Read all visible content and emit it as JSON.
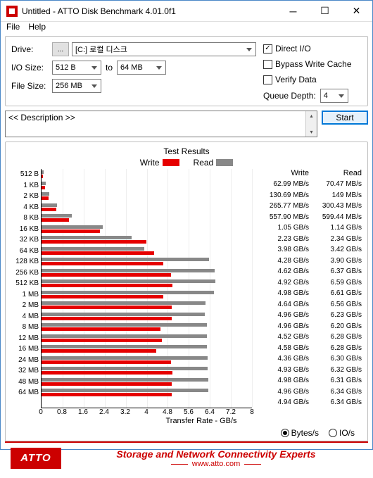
{
  "window": {
    "title": "Untitled - ATTO Disk Benchmark 4.01.0f1"
  },
  "menu": {
    "file": "File",
    "help": "Help"
  },
  "form": {
    "drive_label": "Drive:",
    "drive_value": "[C:] 로컬 디스크",
    "browse": "...",
    "io_size_label": "I/O Size:",
    "io_from": "512 B",
    "to": "to",
    "io_to": "64 MB",
    "file_size_label": "File Size:",
    "file_size": "256 MB"
  },
  "opts": {
    "direct_io": "Direct I/O",
    "bypass": "Bypass Write Cache",
    "verify": "Verify Data",
    "queue_depth_label": "Queue Depth:",
    "queue_depth": "4"
  },
  "description": "<< Description >>",
  "start": "Start",
  "results": {
    "title": "Test Results",
    "legend_write": "Write",
    "legend_read": "Read",
    "xlabel": "Transfer Rate - GB/s",
    "xticks": [
      "0",
      "0.8",
      "1.6",
      "2.4",
      "3.2",
      "4",
      "4.8",
      "5.6",
      "6.4",
      "7.2",
      "8"
    ],
    "header_write": "Write",
    "header_read": "Read"
  },
  "units": {
    "bytes": "Bytes/s",
    "ios": "IO/s"
  },
  "footer": {
    "logo": "ATTO",
    "line1": "Storage and Network Connectivity Experts",
    "line2": "www.atto.com"
  },
  "chart_data": {
    "type": "bar",
    "title": "Test Results",
    "xlabel": "Transfer Rate - GB/s",
    "ylabel": "I/O Size",
    "xlim": [
      0,
      8
    ],
    "series": [
      {
        "name": "Write",
        "color": "#e60000"
      },
      {
        "name": "Read",
        "color": "#888888"
      }
    ],
    "rows": [
      {
        "size": "512 B",
        "write_disp": "62.99 MB/s",
        "read_disp": "70.47 MB/s",
        "write_gbs": 0.063,
        "read_gbs": 0.07
      },
      {
        "size": "1 KB",
        "write_disp": "130.69 MB/s",
        "read_disp": "149 MB/s",
        "write_gbs": 0.131,
        "read_gbs": 0.149
      },
      {
        "size": "2 KB",
        "write_disp": "265.77 MB/s",
        "read_disp": "300.43 MB/s",
        "write_gbs": 0.266,
        "read_gbs": 0.3
      },
      {
        "size": "4 KB",
        "write_disp": "557.90 MB/s",
        "read_disp": "599.44 MB/s",
        "write_gbs": 0.558,
        "read_gbs": 0.599
      },
      {
        "size": "8 KB",
        "write_disp": "1.05 GB/s",
        "read_disp": "1.14 GB/s",
        "write_gbs": 1.05,
        "read_gbs": 1.14
      },
      {
        "size": "16 KB",
        "write_disp": "2.23 GB/s",
        "read_disp": "2.34 GB/s",
        "write_gbs": 2.23,
        "read_gbs": 2.34
      },
      {
        "size": "32 KB",
        "write_disp": "3.98 GB/s",
        "read_disp": "3.42 GB/s",
        "write_gbs": 3.98,
        "read_gbs": 3.42
      },
      {
        "size": "64 KB",
        "write_disp": "4.28 GB/s",
        "read_disp": "3.90 GB/s",
        "write_gbs": 4.28,
        "read_gbs": 3.9
      },
      {
        "size": "128 KB",
        "write_disp": "4.62 GB/s",
        "read_disp": "6.37 GB/s",
        "write_gbs": 4.62,
        "read_gbs": 6.37
      },
      {
        "size": "256 KB",
        "write_disp": "4.92 GB/s",
        "read_disp": "6.59 GB/s",
        "write_gbs": 4.92,
        "read_gbs": 6.59
      },
      {
        "size": "512 KB",
        "write_disp": "4.98 GB/s",
        "read_disp": "6.61 GB/s",
        "write_gbs": 4.98,
        "read_gbs": 6.61
      },
      {
        "size": "1 MB",
        "write_disp": "4.64 GB/s",
        "read_disp": "6.56 GB/s",
        "write_gbs": 4.64,
        "read_gbs": 6.56
      },
      {
        "size": "2 MB",
        "write_disp": "4.96 GB/s",
        "read_disp": "6.23 GB/s",
        "write_gbs": 4.96,
        "read_gbs": 6.23
      },
      {
        "size": "4 MB",
        "write_disp": "4.96 GB/s",
        "read_disp": "6.20 GB/s",
        "write_gbs": 4.96,
        "read_gbs": 6.2
      },
      {
        "size": "8 MB",
        "write_disp": "4.52 GB/s",
        "read_disp": "6.28 GB/s",
        "write_gbs": 4.52,
        "read_gbs": 6.28
      },
      {
        "size": "12 MB",
        "write_disp": "4.58 GB/s",
        "read_disp": "6.28 GB/s",
        "write_gbs": 4.58,
        "read_gbs": 6.28
      },
      {
        "size": "16 MB",
        "write_disp": "4.36 GB/s",
        "read_disp": "6.30 GB/s",
        "write_gbs": 4.36,
        "read_gbs": 6.3
      },
      {
        "size": "24 MB",
        "write_disp": "4.93 GB/s",
        "read_disp": "6.32 GB/s",
        "write_gbs": 4.93,
        "read_gbs": 6.32
      },
      {
        "size": "32 MB",
        "write_disp": "4.98 GB/s",
        "read_disp": "6.31 GB/s",
        "write_gbs": 4.98,
        "read_gbs": 6.31
      },
      {
        "size": "48 MB",
        "write_disp": "4.96 GB/s",
        "read_disp": "6.34 GB/s",
        "write_gbs": 4.96,
        "read_gbs": 6.34
      },
      {
        "size": "64 MB",
        "write_disp": "4.94 GB/s",
        "read_disp": "6.34 GB/s",
        "write_gbs": 4.94,
        "read_gbs": 6.34
      }
    ]
  }
}
